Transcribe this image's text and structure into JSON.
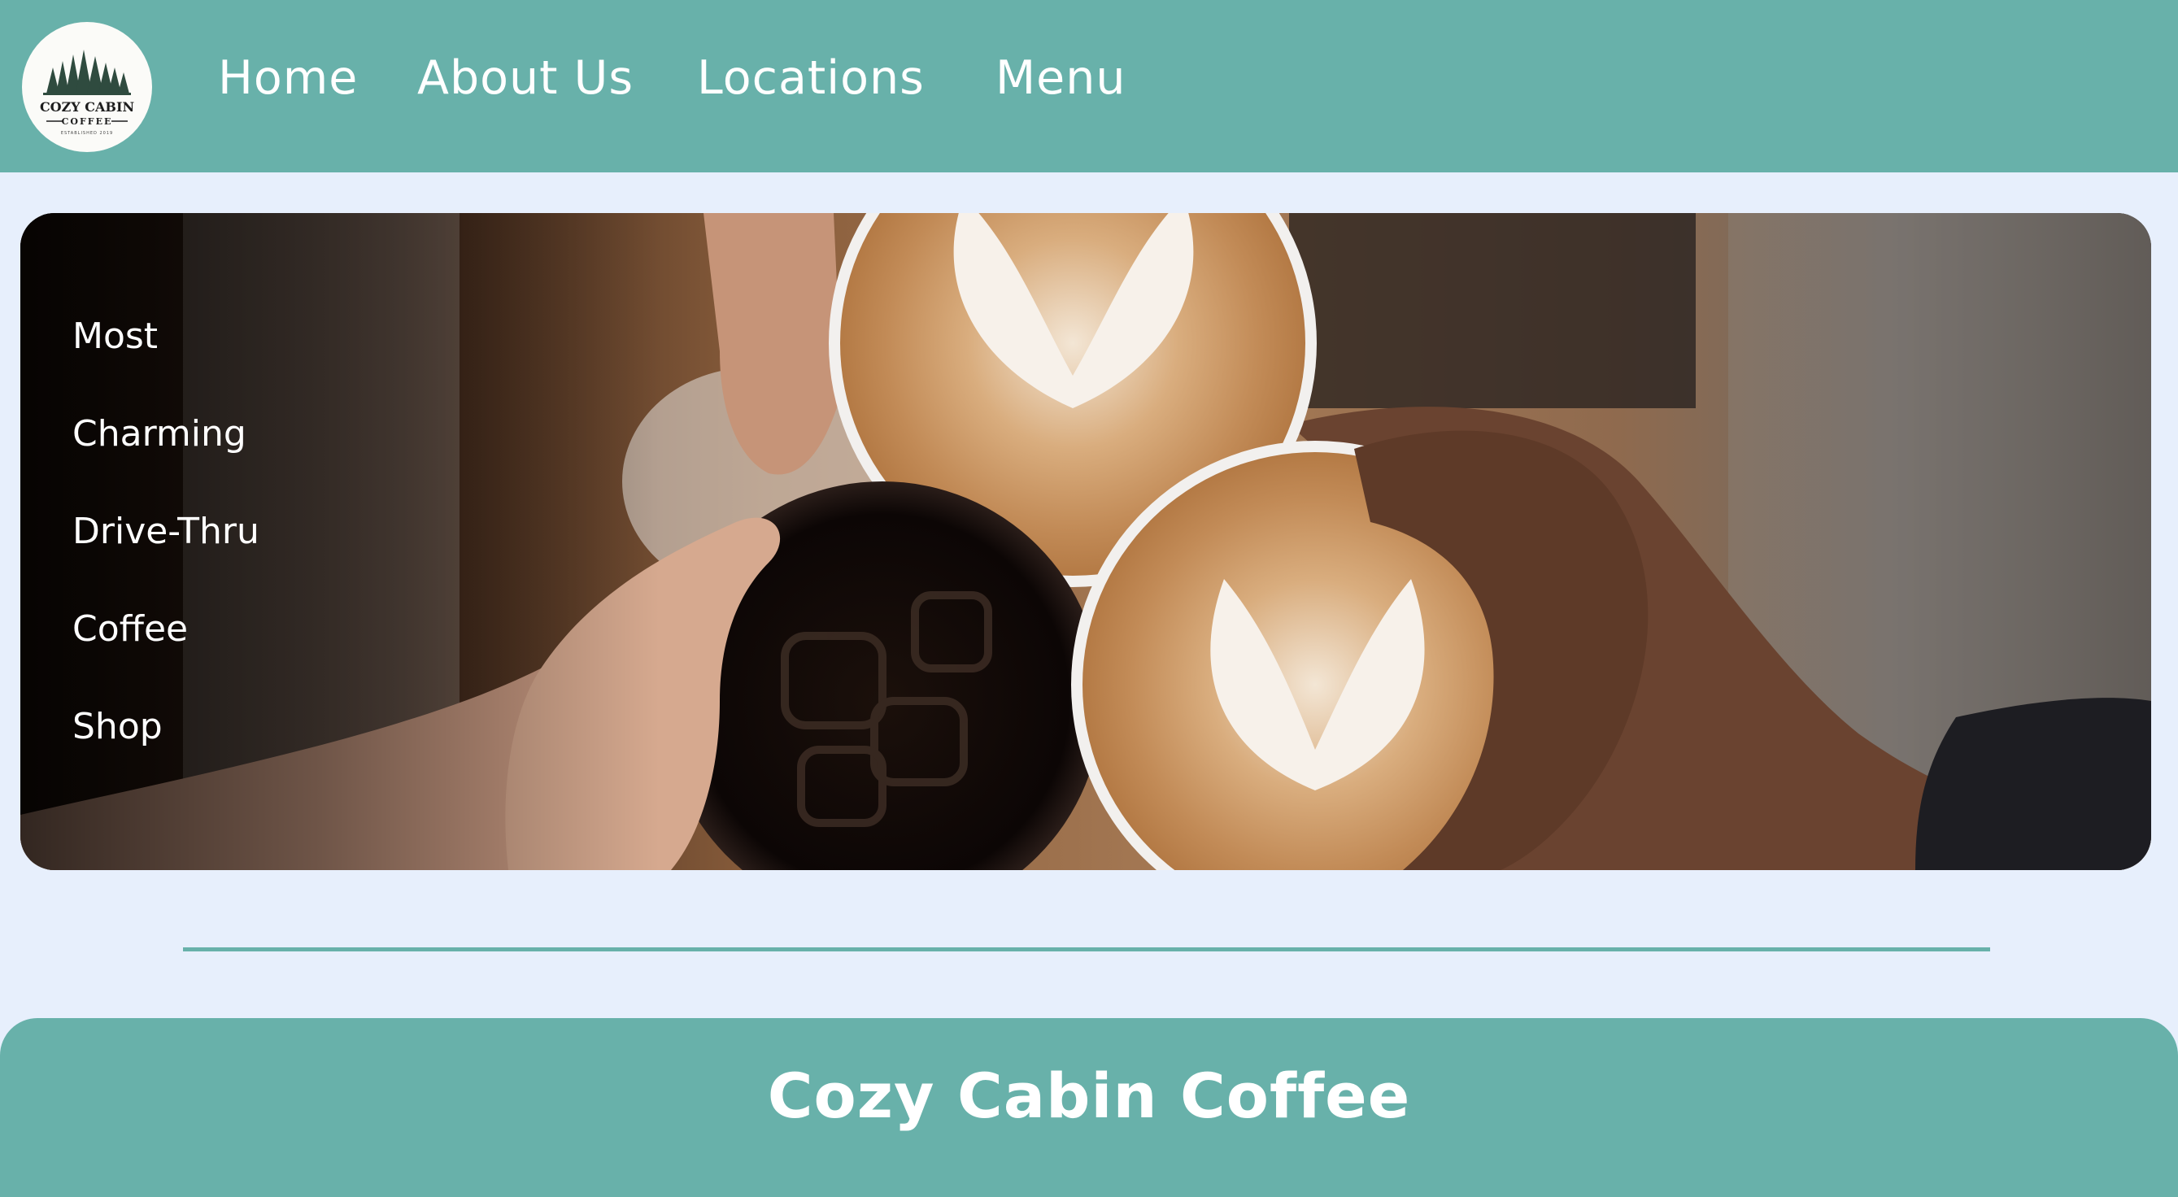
{
  "nav": {
    "logo": {
      "line1": "COZY CABIN",
      "line2": "COFFEE",
      "line3": "ESTABLISHED 2019"
    },
    "links": [
      "Home",
      "About Us",
      "Locations",
      "Menu"
    ]
  },
  "hero": {
    "image": "three-coffee-cups-toast-photo",
    "tagline": [
      "Most",
      "Charming",
      "Drive-Thru",
      "Coffee",
      "Shop"
    ]
  },
  "footer": {
    "title": "Cozy Cabin Coffee"
  },
  "colors": {
    "background": "#e7effc",
    "accent": "#68b1aa",
    "text_on_accent": "#ffffff"
  }
}
